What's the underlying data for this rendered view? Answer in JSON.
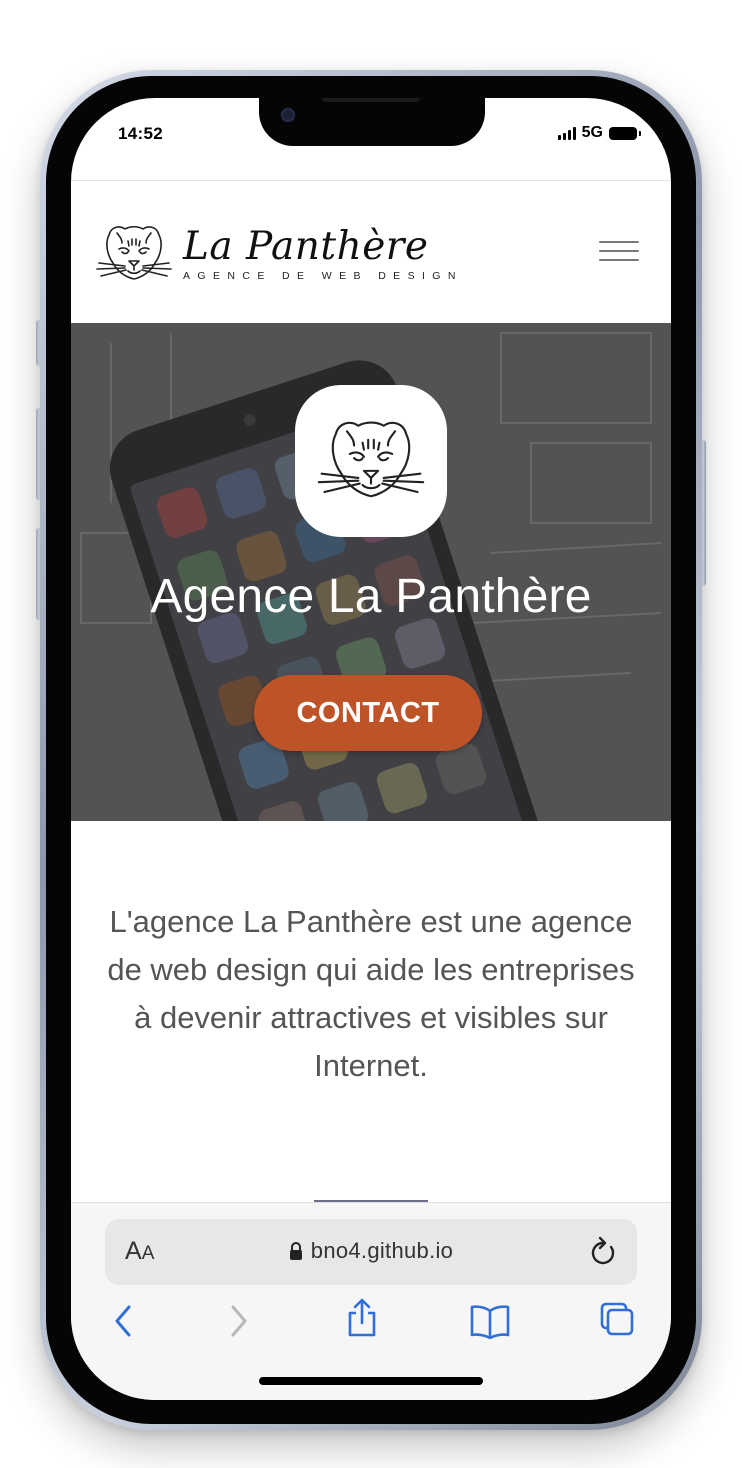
{
  "status_bar": {
    "time": "14:52",
    "network": "5G"
  },
  "site": {
    "logo_name": "La Panthère",
    "logo_tagline": "AGENCE DE WEB DESIGN"
  },
  "hero": {
    "title": "Agence La Panthère",
    "cta_label": "CONTACT"
  },
  "intro": {
    "text": "L'agence La Panthère est une agence de web design qui aide les entreprises à devenir attractives et visibles sur Internet."
  },
  "browser": {
    "aa_big": "A",
    "aa_small": "A",
    "url": "bno4.github.io"
  },
  "colors": {
    "accent": "#bf5328",
    "link_blue": "#2f6fd6",
    "text_grey": "#555555"
  },
  "icons": [
    "panther-logo-icon",
    "hamburger-menu-icon",
    "lock-icon",
    "reload-icon",
    "back-icon",
    "forward-icon",
    "share-icon",
    "bookmarks-icon",
    "tabs-icon",
    "signal-icon",
    "battery-icon"
  ]
}
